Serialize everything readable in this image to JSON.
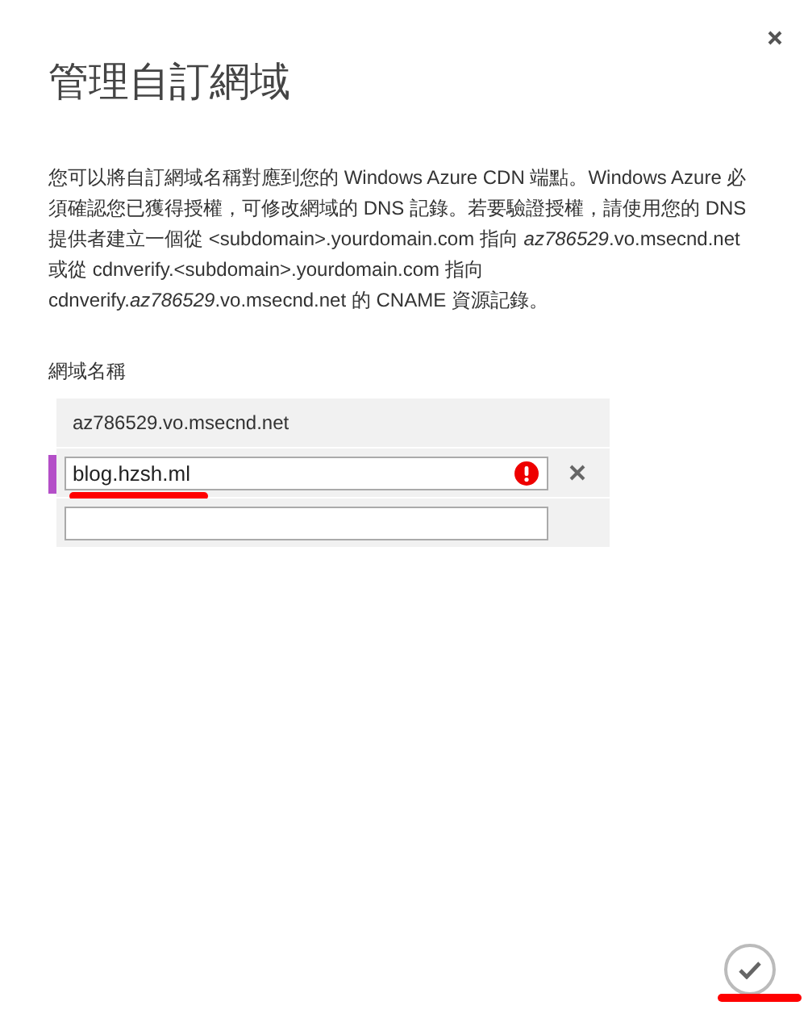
{
  "dialog": {
    "title": "管理自訂網域",
    "description": "您可以將自訂網域名稱對應到您的 Windows Azure CDN 端點。Windows Azure 必須確認您已獲得授權，可修改網域的 DNS 記錄。若要驗證授權，請使用您的 DNS 提供者建立一個從 <subdomain>.yourdomain.com 指向 *az786529*.vo.msecnd.net 或從 cdnverify.<subdomain>.yourdomain.com 指向 cdnverify.*az786529*.vo.msecnd.net 的 CNAME 資源記錄。"
  },
  "domains": {
    "label": "網域名稱",
    "rows": [
      {
        "kind": "static",
        "text": "az786529.vo.msecnd.net",
        "selected": false
      },
      {
        "kind": "input",
        "value": "blog.hzsh.ml",
        "selected": true,
        "error": true,
        "annotated": true
      },
      {
        "kind": "input",
        "value": "",
        "selected": false,
        "error": false,
        "annotated": false
      }
    ]
  },
  "confirm": {
    "annotated": true
  }
}
